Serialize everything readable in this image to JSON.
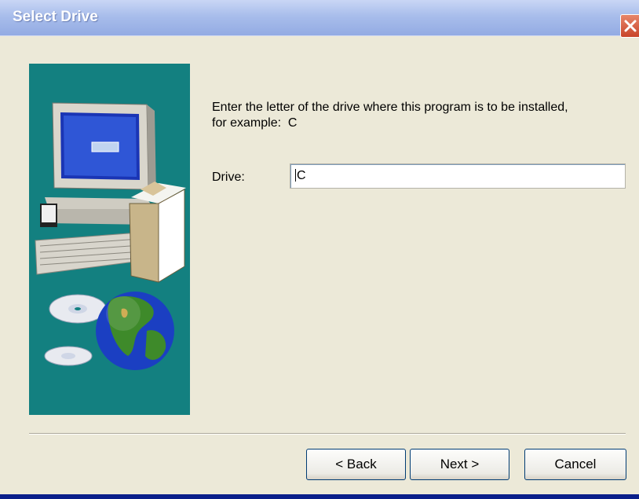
{
  "window": {
    "title": "Select Drive"
  },
  "side_image": {
    "description_icon": "computer-and-globe-illustration"
  },
  "instruction": {
    "line1": "Enter the letter of the drive where this program is to be installed,",
    "line2": "for example:  C"
  },
  "drive": {
    "label": "Drive:",
    "value": "C"
  },
  "buttons": {
    "back": "< Back",
    "next": "Next >",
    "cancel": "Cancel"
  },
  "colors": {
    "panel_teal": "#138080",
    "dialog_bg": "#ece9d8",
    "close_red": "#c8442a"
  }
}
